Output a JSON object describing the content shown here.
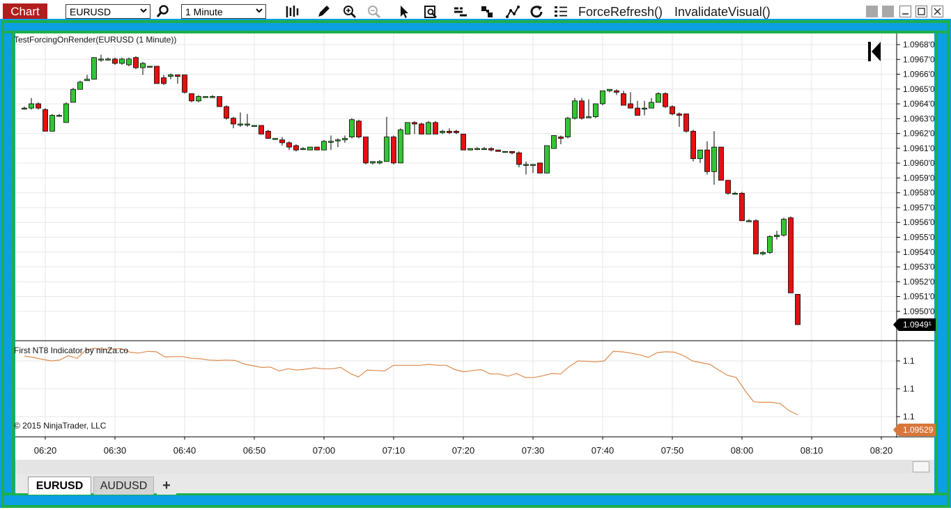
{
  "toolbar": {
    "chart_label": "Chart",
    "instrument": "EURUSD",
    "interval": "1 Minute",
    "force_refresh": "ForceRefresh()",
    "invalidate_visual": "InvalidateVisual()",
    "icons": [
      "magnify-icon",
      "bar-type-icon",
      "pencil-icon",
      "zoom-in-icon",
      "zoom-out-icon",
      "pointer-icon",
      "data-box-icon",
      "indicators-icon",
      "strategies-icon",
      "draw-tools-icon",
      "refresh-icon",
      "properties-icon"
    ]
  },
  "colors": {
    "up": "#33c533",
    "down": "#e51010",
    "indicator_line": "#dd8a4c",
    "price_marker": "#000000",
    "indicator_marker": "#d9763a",
    "frame_blue": "#0aa0e2",
    "frame_green": "#1fae4b"
  },
  "chart": {
    "title": "TestForcingOnRender(EURUSD (1 Minute))",
    "indicator_title": "First NT8 Indicator by ninZa.co",
    "copyright": "© 2015 NinjaTrader, LLC",
    "price_marker": "1.0949¹",
    "indicator_marker": "1.09529"
  },
  "tabs": {
    "items": [
      "EURUSD",
      "AUDUSD"
    ],
    "add_label": "+"
  },
  "chart_data": {
    "type": "candlestick",
    "x_axis": {
      "labels": [
        "06:20",
        "06:30",
        "06:40",
        "06:50",
        "07:00",
        "07:10",
        "07:20",
        "07:30",
        "07:40",
        "07:50",
        "08:00",
        "08:10",
        "08:20"
      ]
    },
    "price_axis": {
      "ticks": [
        "1.0968'0",
        "1.0967'0",
        "1.0966'0",
        "1.0965'0",
        "1.0964'0",
        "1.0963'0",
        "1.0962'0",
        "1.0961'0",
        "1.0960'0",
        "1.0959'0",
        "1.0958'0",
        "1.0957'0",
        "1.0956'0",
        "1.0955'0",
        "1.0954'0",
        "1.0953'0",
        "1.0952'0",
        "1.0951'0",
        "1.0950'0"
      ],
      "range": [
        1.0949,
        1.09685
      ]
    },
    "indicator_axis": {
      "ticks": [
        "1.1",
        "1.1",
        "1.1"
      ]
    },
    "grid": true,
    "candles": [
      {
        "t": "06:17",
        "o": 1.09641,
        "h": 1.09642,
        "l": 1.0964,
        "c": 1.09641
      },
      {
        "t": "06:18",
        "o": 1.09641,
        "h": 1.09648,
        "l": 1.0964,
        "c": 1.09644
      },
      {
        "t": "06:19",
        "o": 1.09644,
        "h": 1.09645,
        "l": 1.0964,
        "c": 1.09641
      },
      {
        "t": "06:20",
        "o": 1.0964,
        "h": 1.09641,
        "l": 1.09625,
        "c": 1.09625
      },
      {
        "t": "06:21",
        "o": 1.09625,
        "h": 1.09637,
        "l": 1.09625,
        "c": 1.09636
      },
      {
        "t": "06:22",
        "o": 1.09636,
        "h": 1.09637,
        "l": 1.09635,
        "c": 1.09636
      },
      {
        "t": "06:23",
        "o": 1.09631,
        "h": 1.09645,
        "l": 1.09631,
        "c": 1.09644
      },
      {
        "t": "06:24",
        "o": 1.09645,
        "h": 1.09655,
        "l": 1.09645,
        "c": 1.09654
      },
      {
        "t": "06:25",
        "o": 1.09654,
        "h": 1.0966,
        "l": 1.09654,
        "c": 1.09659
      },
      {
        "t": "06:26",
        "o": 1.0966,
        "h": 1.09664,
        "l": 1.0966,
        "c": 1.09661
      },
      {
        "t": "06:27",
        "o": 1.09661,
        "h": 1.09676,
        "l": 1.09661,
        "c": 1.09676
      },
      {
        "t": "06:28",
        "o": 1.09675,
        "h": 1.09678,
        "l": 1.09673,
        "c": 1.09675
      },
      {
        "t": "06:29",
        "o": 1.09675,
        "h": 1.09676,
        "l": 1.09674,
        "c": 1.09675
      },
      {
        "t": "06:30",
        "o": 1.09675,
        "h": 1.09676,
        "l": 1.09671,
        "c": 1.09672
      },
      {
        "t": "06:31",
        "o": 1.09672,
        "h": 1.09676,
        "l": 1.09671,
        "c": 1.09675
      },
      {
        "t": "06:32",
        "o": 1.09671,
        "h": 1.09676,
        "l": 1.0967,
        "c": 1.09675
      },
      {
        "t": "06:33",
        "o": 1.09676,
        "h": 1.09677,
        "l": 1.09668,
        "c": 1.09669
      },
      {
        "t": "06:34",
        "o": 1.09669,
        "h": 1.09673,
        "l": 1.09664,
        "c": 1.09672
      },
      {
        "t": "06:35",
        "o": 1.0967,
        "h": 1.0967,
        "l": 1.0967,
        "c": 1.0967
      },
      {
        "t": "06:36",
        "o": 1.0967,
        "h": 1.0967,
        "l": 1.09658,
        "c": 1.09658
      },
      {
        "t": "06:37",
        "o": 1.09662,
        "h": 1.09664,
        "l": 1.09657,
        "c": 1.09658
      },
      {
        "t": "06:38",
        "o": 1.09663,
        "h": 1.09665,
        "l": 1.09661,
        "c": 1.09664
      },
      {
        "t": "06:39",
        "o": 1.09664,
        "h": 1.09664,
        "l": 1.09658,
        "c": 1.09663
      },
      {
        "t": "06:40",
        "o": 1.09664,
        "h": 1.09664,
        "l": 1.09651,
        "c": 1.09652
      },
      {
        "t": "06:41",
        "o": 1.09651,
        "h": 1.09651,
        "l": 1.09645,
        "c": 1.09646
      },
      {
        "t": "06:42",
        "o": 1.09646,
        "h": 1.0965,
        "l": 1.09645,
        "c": 1.09649
      },
      {
        "t": "06:43",
        "o": 1.09649,
        "h": 1.09649,
        "l": 1.09648,
        "c": 1.09649
      },
      {
        "t": "06:44",
        "o": 1.09649,
        "h": 1.0965,
        "l": 1.09648,
        "c": 1.09649
      },
      {
        "t": "06:45",
        "o": 1.09649,
        "h": 1.09649,
        "l": 1.09642,
        "c": 1.09642
      },
      {
        "t": "06:46",
        "o": 1.09642,
        "h": 1.09643,
        "l": 1.09633,
        "c": 1.09634
      },
      {
        "t": "06:47",
        "o": 1.09634,
        "h": 1.09635,
        "l": 1.09627,
        "c": 1.0963
      },
      {
        "t": "06:48",
        "o": 1.0963,
        "h": 1.09638,
        "l": 1.09628,
        "c": 1.0963
      },
      {
        "t": "06:49",
        "o": 1.0963,
        "h": 1.09637,
        "l": 1.09628,
        "c": 1.0963
      },
      {
        "t": "06:50",
        "o": 1.09629,
        "h": 1.09629,
        "l": 1.09629,
        "c": 1.09629
      },
      {
        "t": "06:51",
        "o": 1.09629,
        "h": 1.09629,
        "l": 1.09623,
        "c": 1.09623
      },
      {
        "t": "06:52",
        "o": 1.09625,
        "h": 1.09626,
        "l": 1.0962,
        "c": 1.0962
      },
      {
        "t": "06:53",
        "o": 1.0962,
        "h": 1.0962,
        "l": 1.09619,
        "c": 1.0962
      },
      {
        "t": "06:54",
        "o": 1.09619,
        "h": 1.09621,
        "l": 1.09615,
        "c": 1.09617
      },
      {
        "t": "06:55",
        "o": 1.09617,
        "h": 1.09618,
        "l": 1.09612,
        "c": 1.09614
      },
      {
        "t": "06:56",
        "o": 1.09615,
        "h": 1.09616,
        "l": 1.09611,
        "c": 1.09612
      },
      {
        "t": "06:57",
        "o": 1.09613,
        "h": 1.09614,
        "l": 1.09612,
        "c": 1.09613
      },
      {
        "t": "06:58",
        "o": 1.09612,
        "h": 1.09614,
        "l": 1.09612,
        "c": 1.09614
      },
      {
        "t": "06:59",
        "o": 1.09614,
        "h": 1.09614,
        "l": 1.09612,
        "c": 1.09612
      },
      {
        "t": "07:00",
        "o": 1.09612,
        "h": 1.09619,
        "l": 1.09612,
        "c": 1.09618
      },
      {
        "t": "07:01",
        "o": 1.09618,
        "h": 1.09622,
        "l": 1.09612,
        "c": 1.09618
      },
      {
        "t": "07:02",
        "o": 1.09619,
        "h": 1.0962,
        "l": 1.09614,
        "c": 1.09619
      },
      {
        "t": "07:03",
        "o": 1.09619,
        "h": 1.09622,
        "l": 1.09617,
        "c": 1.0962
      },
      {
        "t": "07:04",
        "o": 1.09621,
        "h": 1.09634,
        "l": 1.0962,
        "c": 1.09633
      },
      {
        "t": "07:05",
        "o": 1.09632,
        "h": 1.09633,
        "l": 1.0962,
        "c": 1.09621
      },
      {
        "t": "07:06",
        "o": 1.09621,
        "h": 1.09621,
        "l": 1.09602,
        "c": 1.09603
      },
      {
        "t": "07:07",
        "o": 1.09603,
        "h": 1.09604,
        "l": 1.09602,
        "c": 1.09604
      },
      {
        "t": "07:08",
        "o": 1.09603,
        "h": 1.09605,
        "l": 1.09602,
        "c": 1.09604
      },
      {
        "t": "07:09",
        "o": 1.09604,
        "h": 1.09635,
        "l": 1.09604,
        "c": 1.09621
      },
      {
        "t": "07:10",
        "o": 1.09621,
        "h": 1.09622,
        "l": 1.09602,
        "c": 1.09603
      },
      {
        "t": "07:11",
        "o": 1.09603,
        "h": 1.09627,
        "l": 1.09603,
        "c": 1.09626
      },
      {
        "t": "07:12",
        "o": 1.09623,
        "h": 1.09631,
        "l": 1.09623,
        "c": 1.09631
      },
      {
        "t": "07:13",
        "o": 1.09631,
        "h": 1.09632,
        "l": 1.09623,
        "c": 1.0963
      },
      {
        "t": "07:14",
        "o": 1.0963,
        "h": 1.09631,
        "l": 1.09623,
        "c": 1.09623
      },
      {
        "t": "07:15",
        "o": 1.09623,
        "h": 1.09632,
        "l": 1.09623,
        "c": 1.09631
      },
      {
        "t": "07:16",
        "o": 1.09631,
        "h": 1.09632,
        "l": 1.09623,
        "c": 1.09623
      },
      {
        "t": "07:17",
        "o": 1.09624,
        "h": 1.09626,
        "l": 1.09623,
        "c": 1.09625
      },
      {
        "t": "07:18",
        "o": 1.09625,
        "h": 1.09627,
        "l": 1.09623,
        "c": 1.09624
      },
      {
        "t": "07:19",
        "o": 1.09625,
        "h": 1.09626,
        "l": 1.09623,
        "c": 1.09624
      },
      {
        "t": "07:20",
        "o": 1.09623,
        "h": 1.09623,
        "l": 1.09612,
        "c": 1.09612
      },
      {
        "t": "07:21",
        "o": 1.09612,
        "h": 1.09613,
        "l": 1.09612,
        "c": 1.09613
      },
      {
        "t": "07:22",
        "o": 1.09613,
        "h": 1.09614,
        "l": 1.09612,
        "c": 1.09613
      },
      {
        "t": "07:23",
        "o": 1.09613,
        "h": 1.09614,
        "l": 1.09612,
        "c": 1.09613
      },
      {
        "t": "07:24",
        "o": 1.09613,
        "h": 1.09614,
        "l": 1.09611,
        "c": 1.09612
      },
      {
        "t": "07:25",
        "o": 1.09612,
        "h": 1.09612,
        "l": 1.09611,
        "c": 1.09611
      },
      {
        "t": "07:26",
        "o": 1.09611,
        "h": 1.09611,
        "l": 1.0961,
        "c": 1.09611
      },
      {
        "t": "07:27",
        "o": 1.09611,
        "h": 1.09611,
        "l": 1.09609,
        "c": 1.0961
      },
      {
        "t": "07:28",
        "o": 1.0961,
        "h": 1.09611,
        "l": 1.096,
        "c": 1.09602
      },
      {
        "t": "07:29",
        "o": 1.09602,
        "h": 1.09604,
        "l": 1.09595,
        "c": 1.09602
      },
      {
        "t": "07:30",
        "o": 1.09602,
        "h": 1.09602,
        "l": 1.09596,
        "c": 1.09602
      },
      {
        "t": "07:31",
        "o": 1.09603,
        "h": 1.09603,
        "l": 1.09596,
        "c": 1.09596
      },
      {
        "t": "07:32",
        "o": 1.09596,
        "h": 1.09615,
        "l": 1.09596,
        "c": 1.09615
      },
      {
        "t": "07:33",
        "o": 1.09613,
        "h": 1.09622,
        "l": 1.09613,
        "c": 1.09622
      },
      {
        "t": "07:34",
        "o": 1.09621,
        "h": 1.09622,
        "l": 1.09616,
        "c": 1.0962
      },
      {
        "t": "07:35",
        "o": 1.09621,
        "h": 1.09635,
        "l": 1.0962,
        "c": 1.09634
      },
      {
        "t": "07:36",
        "o": 1.09634,
        "h": 1.09648,
        "l": 1.09633,
        "c": 1.09646
      },
      {
        "t": "07:37",
        "o": 1.09646,
        "h": 1.09648,
        "l": 1.09633,
        "c": 1.09634
      },
      {
        "t": "07:38",
        "o": 1.09635,
        "h": 1.09647,
        "l": 1.09634,
        "c": 1.09635
      },
      {
        "t": "07:39",
        "o": 1.09635,
        "h": 1.09644,
        "l": 1.09634,
        "c": 1.09644
      },
      {
        "t": "07:40",
        "o": 1.09644,
        "h": 1.09653,
        "l": 1.09643,
        "c": 1.09653
      },
      {
        "t": "07:41",
        "o": 1.09653,
        "h": 1.09654,
        "l": 1.09652,
        "c": 1.09654
      },
      {
        "t": "07:42",
        "o": 1.09653,
        "h": 1.09654,
        "l": 1.0965,
        "c": 1.09652
      },
      {
        "t": "07:43",
        "o": 1.09651,
        "h": 1.09653,
        "l": 1.09643,
        "c": 1.09643
      },
      {
        "t": "07:44",
        "o": 1.09644,
        "h": 1.09652,
        "l": 1.09641,
        "c": 1.09641
      },
      {
        "t": "07:45",
        "o": 1.09641,
        "h": 1.09646,
        "l": 1.09636,
        "c": 1.09636
      },
      {
        "t": "07:46",
        "o": 1.09641,
        "h": 1.09646,
        "l": 1.09636,
        "c": 1.09641
      },
      {
        "t": "07:47",
        "o": 1.09641,
        "h": 1.09648,
        "l": 1.09641,
        "c": 1.09645
      },
      {
        "t": "07:48",
        "o": 1.09645,
        "h": 1.09652,
        "l": 1.09645,
        "c": 1.09651
      },
      {
        "t": "07:49",
        "o": 1.09651,
        "h": 1.09652,
        "l": 1.09641,
        "c": 1.09642
      },
      {
        "t": "07:50",
        "o": 1.09642,
        "h": 1.09643,
        "l": 1.09636,
        "c": 1.09637
      },
      {
        "t": "07:51",
        "o": 1.09637,
        "h": 1.09638,
        "l": 1.09628,
        "c": 1.09636
      },
      {
        "t": "07:52",
        "o": 1.09637,
        "h": 1.09637,
        "l": 1.09624,
        "c": 1.09625
      },
      {
        "t": "07:53",
        "o": 1.09625,
        "h": 1.09626,
        "l": 1.09604,
        "c": 1.09606
      },
      {
        "t": "07:54",
        "o": 1.09606,
        "h": 1.09612,
        "l": 1.09603,
        "c": 1.09612
      },
      {
        "t": "07:55",
        "o": 1.09612,
        "h": 1.09618,
        "l": 1.09595,
        "c": 1.09597
      },
      {
        "t": "07:56",
        "o": 1.09597,
        "h": 1.09625,
        "l": 1.09588,
        "c": 1.09614
      },
      {
        "t": "07:57",
        "o": 1.09614,
        "h": 1.09614,
        "l": 1.09591,
        "c": 1.09591
      },
      {
        "t": "07:58",
        "o": 1.09591,
        "h": 1.09591,
        "l": 1.09581,
        "c": 1.09582
      },
      {
        "t": "07:59",
        "o": 1.09582,
        "h": 1.09583,
        "l": 1.09582,
        "c": 1.09582
      },
      {
        "t": "08:00",
        "o": 1.09582,
        "h": 1.09583,
        "l": 1.09563,
        "c": 1.09563
      },
      {
        "t": "08:01",
        "o": 1.09563,
        "h": 1.09564,
        "l": 1.09563,
        "c": 1.09563
      },
      {
        "t": "08:02",
        "o": 1.09563,
        "h": 1.09564,
        "l": 1.0954,
        "c": 1.0954
      },
      {
        "t": "08:03",
        "o": 1.0954,
        "h": 1.09542,
        "l": 1.09539,
        "c": 1.09541
      },
      {
        "t": "08:04",
        "o": 1.09541,
        "h": 1.09553,
        "l": 1.0954,
        "c": 1.09552
      },
      {
        "t": "08:05",
        "o": 1.09552,
        "h": 1.09556,
        "l": 1.0955,
        "c": 1.09553
      },
      {
        "t": "08:06",
        "o": 1.09553,
        "h": 1.09565,
        "l": 1.09552,
        "c": 1.09564
      },
      {
        "t": "08:07",
        "o": 1.09565,
        "h": 1.09566,
        "l": 1.09513,
        "c": 1.09513
      },
      {
        "t": "08:08",
        "o": 1.09512,
        "h": 1.09512,
        "l": 1.09491,
        "c": 1.09491
      }
    ],
    "indicator": {
      "name": "First NT8 Indicator by ninZa.co",
      "values": [
        0.79,
        0.76,
        0.72,
        0.68,
        0.7,
        0.8,
        0.74,
        0.93,
        0.97,
        0.95,
        0.95,
        0.96,
        0.88,
        0.86,
        0.9,
        0.89,
        0.77,
        0.78,
        0.78,
        0.74,
        0.73,
        0.7,
        0.69,
        0.7,
        0.69,
        0.61,
        0.57,
        0.53,
        0.54,
        0.45,
        0.5,
        0.47,
        0.49,
        0.52,
        0.5,
        0.5,
        0.53,
        0.4,
        0.31,
        0.47,
        0.46,
        0.45,
        0.58,
        0.58,
        0.58,
        0.58,
        0.6,
        0.58,
        0.58,
        0.48,
        0.43,
        0.46,
        0.48,
        0.38,
        0.38,
        0.33,
        0.39,
        0.3,
        0.3,
        0.34,
        0.39,
        0.38,
        0.55,
        0.68,
        0.67,
        0.66,
        0.68,
        0.9,
        0.89,
        0.86,
        0.82,
        0.76,
        0.87,
        0.89,
        0.88,
        0.8,
        0.68,
        0.64,
        0.6,
        0.47,
        0.35,
        0.3,
        0.0,
        -0.26,
        -0.27,
        -0.27,
        -0.3,
        -0.46,
        -0.56
      ],
      "marker": "1.09529"
    }
  }
}
